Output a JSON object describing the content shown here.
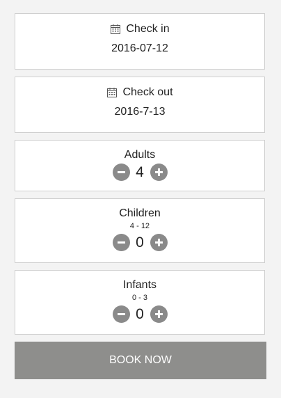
{
  "checkin": {
    "label": "Check in",
    "value": "2016-07-12",
    "icon": "calendar-icon"
  },
  "checkout": {
    "label": "Check out",
    "value": "2016-7-13",
    "icon": "calendar-icon"
  },
  "adults": {
    "label": "Adults",
    "count": "4"
  },
  "children": {
    "label": "Children",
    "range": "4 - 12",
    "count": "0"
  },
  "infants": {
    "label": "Infants",
    "range": "0 - 3",
    "count": "0"
  },
  "book_button": {
    "label": "BOOK NOW"
  },
  "colors": {
    "background": "#f3f3f3",
    "card": "#ffffff",
    "border": "#cfcfcf",
    "stepper_button": "#8a8a8a",
    "book_button": "#8e8e8c",
    "text": "#222222"
  }
}
